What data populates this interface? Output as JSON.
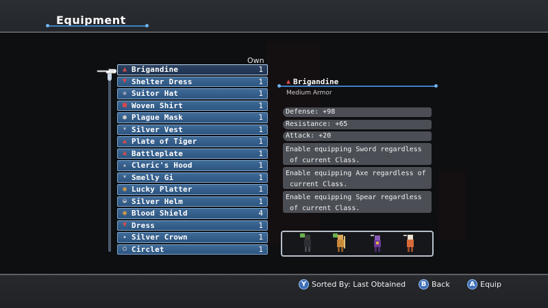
{
  "header": {
    "title": "Equipment"
  },
  "list": {
    "own_label": "Own",
    "items": [
      {
        "name": "Brigandine",
        "count": "1",
        "icon": "armor-icon",
        "selected": true
      },
      {
        "name": "Shelter Dress",
        "count": "1",
        "icon": "dress-icon"
      },
      {
        "name": "Suitor Hat",
        "count": "1",
        "icon": "hat-icon"
      },
      {
        "name": "Woven Shirt",
        "count": "1",
        "icon": "shirt-icon"
      },
      {
        "name": "Plague Mask",
        "count": "1",
        "icon": "mask-icon"
      },
      {
        "name": "Silver Vest",
        "count": "1",
        "icon": "vest-icon"
      },
      {
        "name": "Plate of Tiger",
        "count": "1",
        "icon": "armor-icon"
      },
      {
        "name": "Battleplate",
        "count": "1",
        "icon": "armor-icon"
      },
      {
        "name": "Cleric's Hood",
        "count": "1",
        "icon": "hood-icon"
      },
      {
        "name": "Smelly Gi",
        "count": "1",
        "icon": "vest-icon"
      },
      {
        "name": "Lucky Platter",
        "count": "1",
        "icon": "shield-icon"
      },
      {
        "name": "Silver Helm",
        "count": "1",
        "icon": "helm-icon"
      },
      {
        "name": "Blood Shield",
        "count": "4",
        "icon": "shield-icon"
      },
      {
        "name": "Dress",
        "count": "1",
        "icon": "dress-icon"
      },
      {
        "name": "Silver Crown",
        "count": "1",
        "icon": "crown-icon"
      },
      {
        "name": "Circlet",
        "count": "1",
        "icon": "circlet-icon"
      }
    ]
  },
  "detail": {
    "name": "Brigandine",
    "type": "Medium Armor",
    "stats": [
      "Defense:  +98",
      "Resistance:  +65",
      "Attack:  +20"
    ],
    "effects": [
      "Enable equipping Sword regardless\n of current Class.",
      "Enable equipping Axe regardless of\n current Class.",
      "Enable equipping Spear regardless\n of current Class."
    ]
  },
  "footer": {
    "sort_button": "Y",
    "sort_label": "Sorted By: Last Obtained",
    "back_button": "B",
    "back_label": "Back",
    "equip_button": "A",
    "equip_label": "Equip"
  },
  "colors": {
    "item_bg": "#2d5580",
    "accent_line": "#3d82c8",
    "stat_bg": "#4b4f55"
  }
}
